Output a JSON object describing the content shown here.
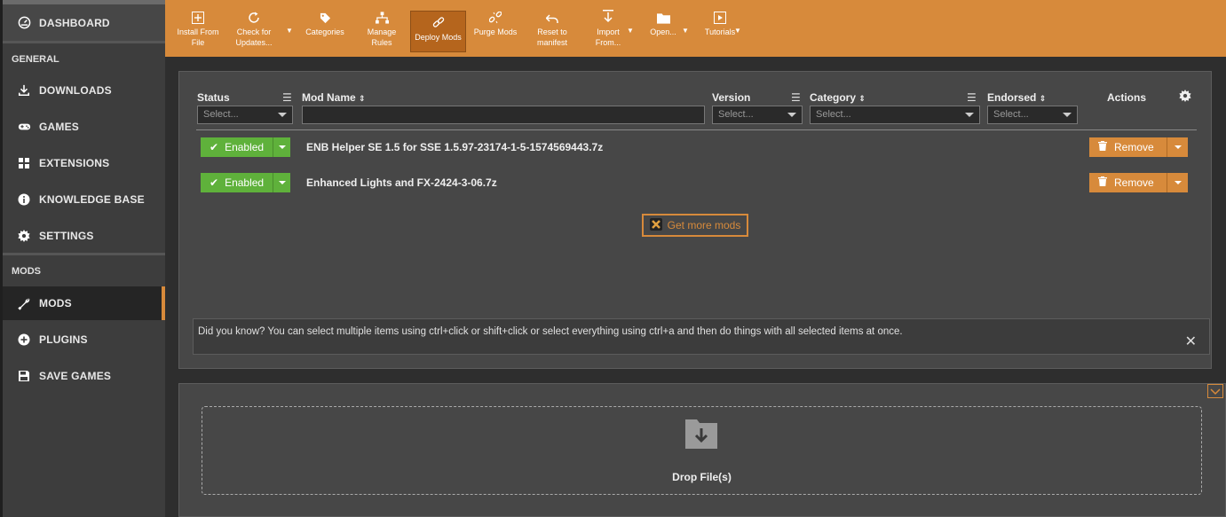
{
  "sidebar": {
    "dashboard": "DASHBOARD",
    "sections": {
      "general": "GENERAL",
      "mods": "MODS"
    },
    "items": {
      "downloads": "DOWNLOADS",
      "games": "GAMES",
      "extensions": "EXTENSIONS",
      "knowledge_base": "KNOWLEDGE BASE",
      "settings": "SETTINGS",
      "mods": "MODS",
      "plugins": "PLUGINS",
      "save_games": "SAVE GAMES"
    }
  },
  "toolbar": {
    "install_l1": "Install From",
    "install_l2": "File",
    "check_l1": "Check for",
    "check_l2": "Updates...",
    "categories": "Categories",
    "manage_l1": "Manage",
    "manage_l2": "Rules",
    "deploy": "Deploy Mods",
    "purge": "Purge Mods",
    "reset_l1": "Reset to",
    "reset_l2": "manifest",
    "import_l1": "Import",
    "import_l2": "From...",
    "open": "Open...",
    "tutorials": "Tutorials"
  },
  "table": {
    "headers": {
      "status": "Status",
      "mod_name": "Mod Name",
      "version": "Version",
      "category": "Category",
      "endorsed": "Endorsed",
      "actions": "Actions"
    },
    "filter_placeholder": "Select...",
    "rows": [
      {
        "status": "Enabled",
        "name": "ENB Helper SE 1.5 for SSE 1.5.97-23174-1-5-1574569443.7z",
        "action": "Remove"
      },
      {
        "status": "Enabled",
        "name": "Enhanced Lights and FX-2424-3-06.7z",
        "action": "Remove"
      }
    ]
  },
  "get_more": "Get more mods",
  "tip": "Did you know? You can select multiple items using ctrl+click or shift+click or select everything using ctrl+a and then do things with all selected items at once.",
  "drop": "Drop File(s)",
  "colors": {
    "accent": "#d78a3b",
    "enabled": "#5fb13b"
  }
}
